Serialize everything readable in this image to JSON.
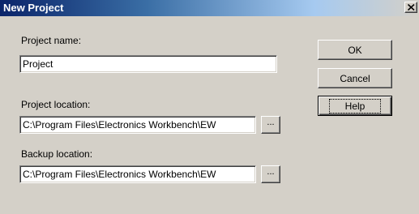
{
  "window": {
    "title": "New Project",
    "close_glyph": "✕"
  },
  "form": {
    "project_name_label": "Project name:",
    "project_name_value": "Project",
    "project_location_label": "Project location:",
    "project_location_value": "C:\\Program Files\\Electronics Workbench\\EW",
    "backup_location_label": "Backup location:",
    "backup_location_value": "C:\\Program Files\\Electronics Workbench\\EW",
    "browse_label": "..."
  },
  "buttons": {
    "ok_label": "OK",
    "cancel_label": "Cancel",
    "help_label": "Help"
  },
  "colors": {
    "titlebar_start": "#0a246a",
    "titlebar_end": "#a6caf0",
    "dialog_face": "#d4d0c8"
  },
  "icons": {
    "close": "close-icon"
  }
}
